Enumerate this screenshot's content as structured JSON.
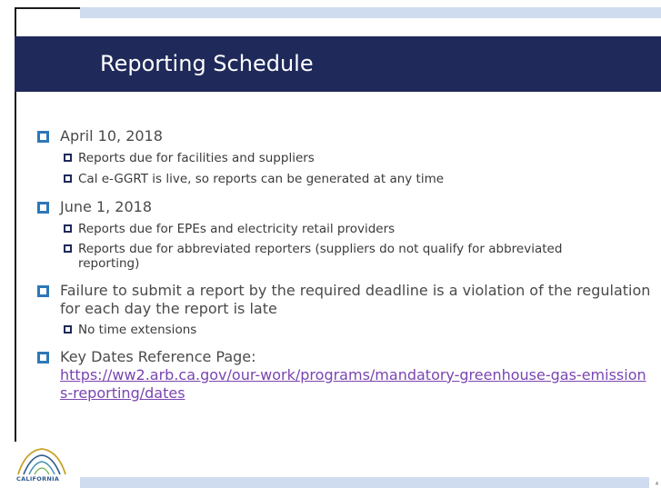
{
  "slide": {
    "title": "Reporting Schedule",
    "page_number": "4",
    "logo_text": "CALIFORNIA"
  },
  "colors": {
    "title_bar": "#1f2a5a",
    "band": "#cfdcef",
    "bullet_l1": "#2d78b8",
    "bullet_l2": "#1f2a5a",
    "link": "#7a45b0"
  },
  "content": {
    "item1": {
      "text": "April 10, 2018",
      "sub": [
        "Reports due for facilities and suppliers",
        "Cal e-GGRT is live, so reports can be generated at any time"
      ]
    },
    "item2": {
      "text": "June 1, 2018",
      "sub": [
        "Reports due for EPEs and electricity retail providers",
        "Reports due for abbreviated reporters (suppliers do not qualify for abbreviated reporting)"
      ]
    },
    "item3": {
      "text": "Failure to submit a report by the required deadline is a violation of the regulation for each day the report is late",
      "sub": [
        "No time extensions"
      ]
    },
    "item4": {
      "text": "Key Dates Reference Page:",
      "link": "https://ww2.arb.ca.gov/our-work/programs/mandatory-greenhouse-gas-emissions-reporting/dates"
    }
  }
}
